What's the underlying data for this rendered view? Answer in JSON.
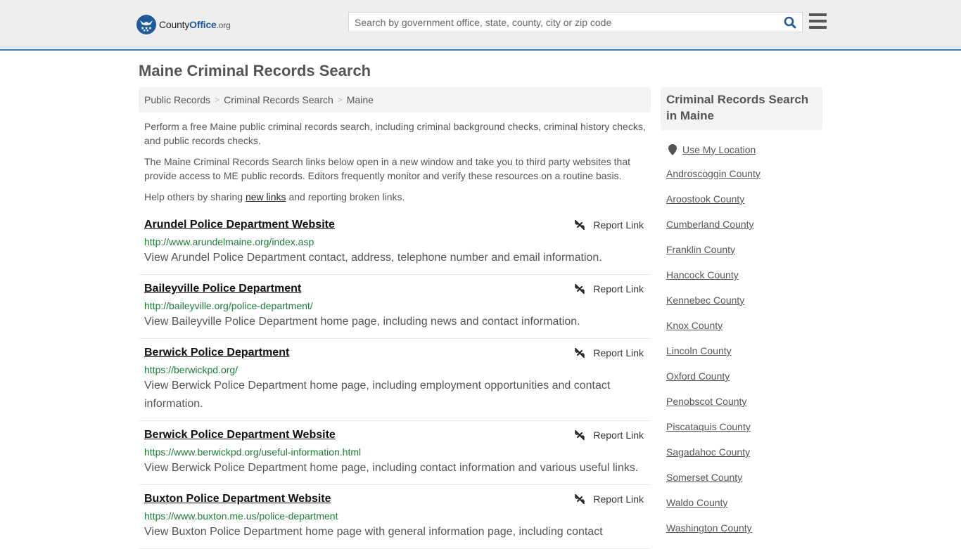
{
  "header": {
    "logo": {
      "name_part1": "County",
      "name_part2": "Office",
      "name_part3": ".org",
      "brand_color": "#1f5b9a"
    },
    "search": {
      "placeholder": "Search by government office, state, county, city or zip code",
      "value": ""
    },
    "search_icon": "search-icon",
    "menu_icon": "hamburger-menu-icon"
  },
  "page": {
    "title": "Maine Criminal Records Search"
  },
  "breadcrumb": [
    {
      "label": "Public Records"
    },
    {
      "label": "Criminal Records Search"
    },
    {
      "label": "Maine"
    }
  ],
  "breadcrumb_separator": ">",
  "intro": {
    "p1": "Perform a free Maine public criminal records search, including criminal background checks, criminal history checks, and public records checks.",
    "p2": "The Maine Criminal Records Search links below open in a new window and take you to third party websites that provide access to ME public records. Editors frequently monitor and verify these resources on a routine basis.",
    "p3_before": "Help others by sharing ",
    "p3_link": "new links",
    "p3_after": " and reporting broken links."
  },
  "report_label": "Report Link",
  "results": [
    {
      "title": "Arundel Police Department Website",
      "url": "http://www.arundelmaine.org/index.asp",
      "description": "View Arundel Police Department contact, address, telephone number and email information."
    },
    {
      "title": "Baileyville Police Department",
      "url": "http://baileyville.org/police-department/",
      "description": "View Baileyville Police Department home page, including news and contact information."
    },
    {
      "title": "Berwick Police Department",
      "url": "https://berwickpd.org/",
      "description": "View Berwick Police Department home page, including employment opportunities and contact information."
    },
    {
      "title": "Berwick Police Department Website",
      "url": "https://www.berwickpd.org/useful-information.html",
      "description": "View Berwick Police Department home page, including contact information and various useful links."
    },
    {
      "title": "Buxton Police Department Website",
      "url": "https://www.buxton.me.us/police-department",
      "description": "View Buxton Police Department home page with general information page, including contact"
    }
  ],
  "sidebar": {
    "heading": "Criminal Records Search in Maine",
    "location_label": "Use My Location",
    "counties": [
      "Androscoggin County",
      "Aroostook County",
      "Cumberland County",
      "Franklin County",
      "Hancock County",
      "Kennebec County",
      "Knox County",
      "Lincoln County",
      "Oxford County",
      "Penobscot County",
      "Piscataquis County",
      "Sagadahoc County",
      "Somerset County",
      "Waldo County",
      "Washington County"
    ]
  },
  "colors": {
    "header_bg": "#eeeeee",
    "header_border": "#3a7fb0",
    "url_green": "#1e7b34",
    "text_gray": "#555555"
  }
}
